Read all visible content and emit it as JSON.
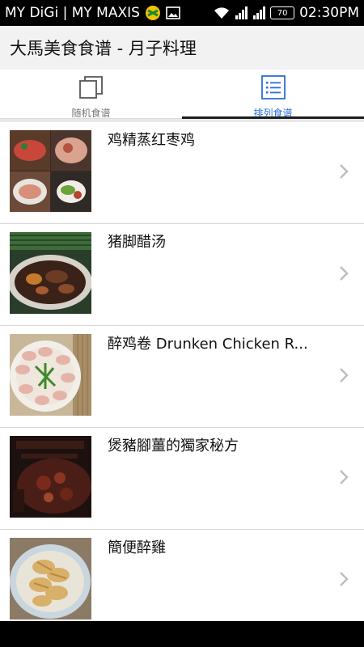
{
  "status_bar": {
    "carrier": "MY DiGi | MY MAXIS",
    "battery": "70",
    "time": "02:30PM"
  },
  "app_bar": {
    "title": "大馬美食食谱 - 月子料理"
  },
  "tabs": [
    {
      "label": "随机食谱",
      "icon": "copy-squares-icon",
      "active": false
    },
    {
      "label": "排列食谱",
      "icon": "list-icon",
      "active": true
    }
  ],
  "recipes": [
    {
      "title": "鸡精蒸红枣鸡",
      "thumbnail": "steamed-chicken-photo"
    },
    {
      "title": "猪脚醋汤",
      "thumbnail": "pork-vinegar-soup-photo"
    },
    {
      "title": "醉鸡卷 Drunken Chicken R...",
      "thumbnail": "drunken-chicken-roll-photo"
    },
    {
      "title": "煲豬腳薑的獨家秘方",
      "thumbnail": "pork-ginger-poster-photo"
    },
    {
      "title": "簡便醉雞",
      "thumbnail": "simple-drunken-chicken-photo"
    }
  ],
  "colors": {
    "accent": "#2b6fd8",
    "appbar_bg": "#f2f2f2",
    "statusbar_bg": "#000000"
  }
}
